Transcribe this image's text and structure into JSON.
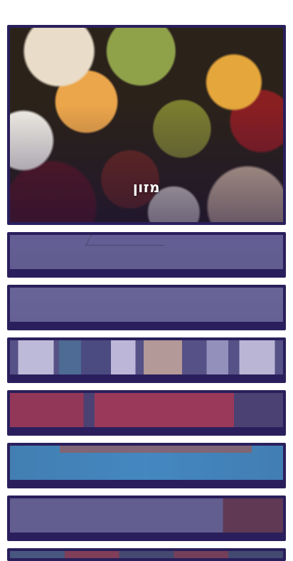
{
  "categories": [
    {
      "title": "מזון",
      "image_icon": "legumes-photo"
    },
    {
      "title": "",
      "image_icon": "category-photo"
    },
    {
      "title": "",
      "image_icon": "category-photo"
    },
    {
      "title": "",
      "image_icon": "toys-photo"
    },
    {
      "title": "",
      "image_icon": "red-dish-photo"
    },
    {
      "title": "",
      "image_icon": "blue-tray-photo"
    },
    {
      "title": "",
      "image_icon": "category-photo"
    },
    {
      "title": "",
      "image_icon": "category-photo"
    }
  ],
  "colors": {
    "frame": "#2a1f5c",
    "text": "#ffffff"
  }
}
